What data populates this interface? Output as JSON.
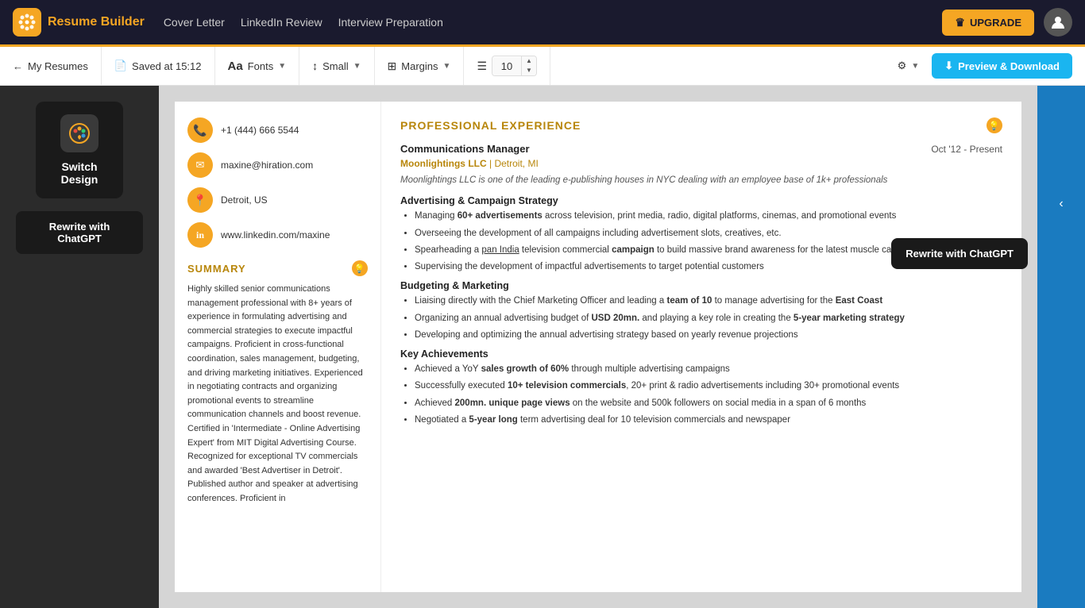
{
  "nav": {
    "logo_icon": "⬡",
    "brand": "Resume Builder",
    "links": [
      "Cover Letter",
      "LinkedIn Review",
      "Interview Preparation"
    ],
    "upgrade_label": "UPGRADE",
    "crown": "♛"
  },
  "toolbar": {
    "back_label": "My Resumes",
    "saved_label": "Saved at 15:12",
    "fonts_label": "Fonts",
    "size_label": "Small",
    "margins_label": "Margins",
    "line_spacing_value": "10",
    "preview_label": "Preview & Download"
  },
  "left_panel": {
    "switch_design_label": "Switch Design",
    "rewrite_chatgpt_label": "Rewrite with ChatGPT"
  },
  "resume_left": {
    "contact": [
      {
        "icon": "📞",
        "text": "+1 (444) 666 5544"
      },
      {
        "icon": "✉",
        "text": "maxine@hiration.com"
      },
      {
        "icon": "📍",
        "text": "Detroit, US"
      },
      {
        "icon": "in",
        "text": "www.linkedin.com/maxine"
      }
    ],
    "summary_title": "SUMMARY",
    "summary_text": "Highly skilled senior communications management professional with 8+ years of experience in formulating advertising and commercial strategies to execute impactful campaigns. Proficient in cross-functional coordination, sales management, budgeting, and driving marketing initiatives. Experienced in negotiating contracts and organizing promotional events to streamline communication channels and boost revenue. Certified in 'Intermediate - Online Advertising Expert' from MIT Digital Advertising Course. Recognized for exceptional TV commercials and awarded 'Best Advertiser in Detroit'. Published author and speaker at advertising conferences. Proficient in"
  },
  "resume_right": {
    "section_title": "PROFESSIONAL EXPERIENCE",
    "job_title": "Communications Manager",
    "job_date": "Oct '12 -  Present",
    "company": "Moonlightings LLC",
    "company_location": "Detroit, MI",
    "job_desc_italic": "Moonlightings LLC is one of the leading e-publishing houses in NYC dealing with an employee base of 1k+ professionals",
    "subsections": [
      {
        "title": "Advertising & Campaign Strategy",
        "bullets": [
          "Managing 60+ advertisements across television, print media, radio, digital platforms, cinemas, and promotional events",
          "Overseeing the development of all campaigns including advertisement slots, creatives, etc.",
          "Spearheading a pan India television commercial campaign to build massive brand awareness for the latest muscle car model",
          "Supervising the development of impactful advertisements to target potential customers"
        ],
        "bold_terms": [
          "60+ advertisements",
          "pan India",
          "campaign"
        ]
      },
      {
        "title": "Budgeting & Marketing",
        "bullets": [
          "Liaising directly with the Chief Marketing Officer and leading a team of 10 to manage advertising for the East Coast",
          "Organizing an annual advertising budget of USD 20mn. and playing a key role in creating the 5-year marketing strategy",
          "Developing and optimizing the annual advertising strategy based on yearly revenue projections"
        ],
        "bold_terms": [
          "team of 10",
          "East Coast",
          "USD 20mn.",
          "5-year marketing strategy"
        ]
      },
      {
        "title": "Key Achievements",
        "bullets": [
          "Achieved a YoY sales growth of 60% through multiple advertising campaigns",
          "Successfully executed 10+ television commercials, 20+ print & radio advertisements including 30+ promotional events",
          "Achieved 200mn. unique page views on the website and 500k followers on social media in a span of 6 months",
          "Negotiated a 5-year long term advertising deal for 10 television commercials and newspaper"
        ],
        "bold_terms": [
          "sales growth of 60%",
          "10+ television commercials",
          "200mn. unique page views",
          "5-year long"
        ]
      }
    ]
  },
  "chatgpt_panel": {
    "label": "Rewrite with ChatGPT"
  },
  "colors": {
    "gold": "#b8860b",
    "nav_bg": "#1a1a2e",
    "upgrade_bg": "#f5a623",
    "preview_bg": "#1ab5f0",
    "left_panel_bg": "#2b2b2b",
    "right_panel_bg": "#1a7bc0"
  }
}
